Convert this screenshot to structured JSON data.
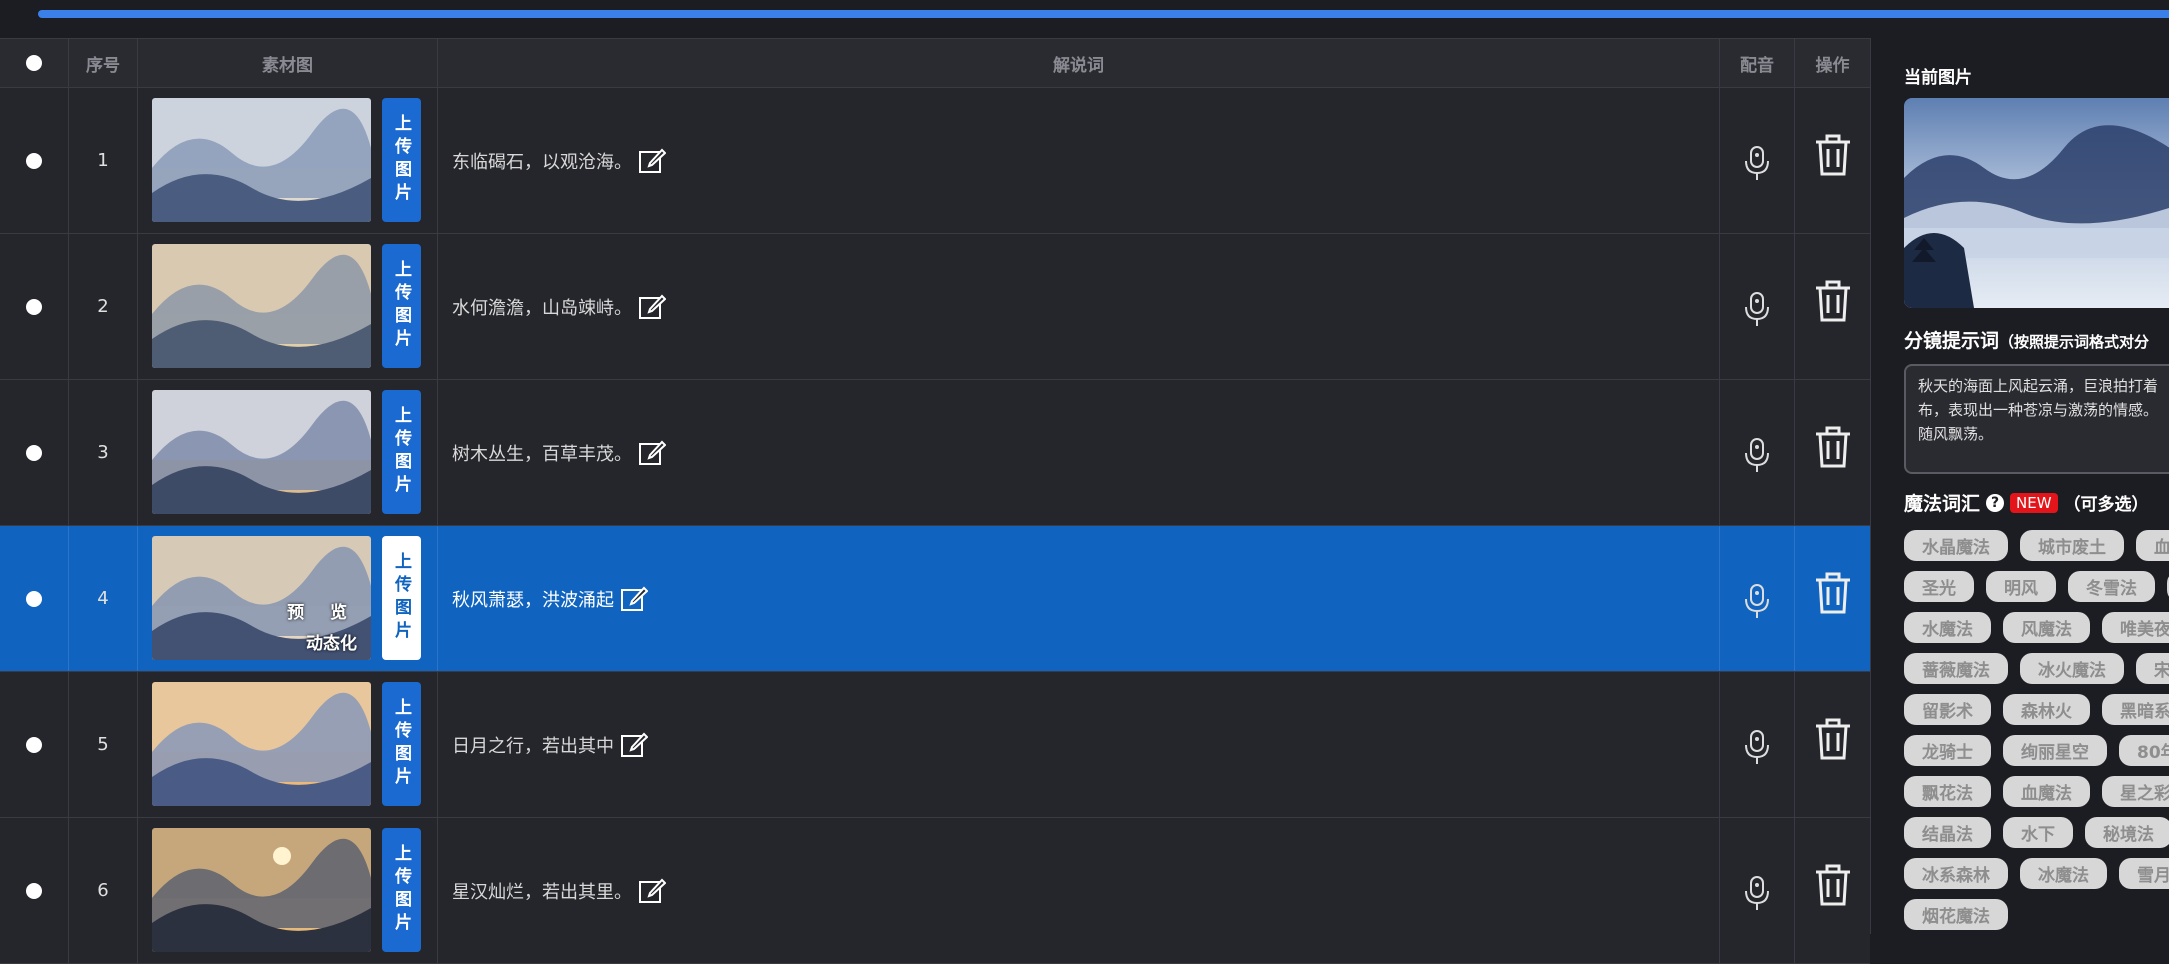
{
  "progress": {
    "value": 1.0,
    "color": "#3b7fe8"
  },
  "table": {
    "headers": {
      "index": "序号",
      "image": "素材图",
      "narration": "解说词",
      "voice": "配音",
      "action": "操作"
    },
    "upload_label": "上传图片",
    "rows": [
      {
        "index": "1",
        "narration": "东临碣石，以观沧海。",
        "selected": false
      },
      {
        "index": "2",
        "narration": "水何澹澹，山岛竦峙。",
        "selected": false
      },
      {
        "index": "3",
        "narration": "树木丛生，百草丰茂。",
        "selected": false
      },
      {
        "index": "4",
        "narration": "秋风萧瑟，洪波涌起",
        "selected": true,
        "overlay_preview": "预 览",
        "overlay_animate": "动态化"
      },
      {
        "index": "5",
        "narration": "日月之行，若出其中",
        "selected": false
      },
      {
        "index": "6",
        "narration": "星汉灿烂，若出其里。",
        "selected": false
      }
    ]
  },
  "panel": {
    "current_image_title": "当前图片",
    "prompt_title": "分镜提示词",
    "prompt_subtitle": "（按照提示词格式对分",
    "prompt_lines": [
      "秋天的海面上风起云涌，巨浪拍打着",
      "布，表现出一种苍凉与激荡的情感。",
      "随风飘荡。"
    ],
    "magic_title": "魔法词汇",
    "help_icon": "?",
    "new_badge": "NEW",
    "multi_select": "（可多选）",
    "tag_rows": [
      [
        "水晶魔法",
        "城市废土",
        "血"
      ],
      [
        "圣光",
        "明风",
        "冬雪法",
        ""
      ],
      [
        "水魔法",
        "风魔法",
        "唯美夜"
      ],
      [
        "蔷薇魔法",
        "冰火魔法",
        "宋"
      ],
      [
        "留影术",
        "森林火",
        "黑暗系"
      ],
      [
        "龙骑士",
        "绚丽星空",
        "80年"
      ],
      [
        "飘花法",
        "血魔法",
        "星之彩"
      ],
      [
        "结晶法",
        "水下",
        "秘境法"
      ],
      [
        "冰系森林",
        "冰魔法",
        "雪月"
      ],
      [
        "烟花魔法"
      ]
    ]
  }
}
